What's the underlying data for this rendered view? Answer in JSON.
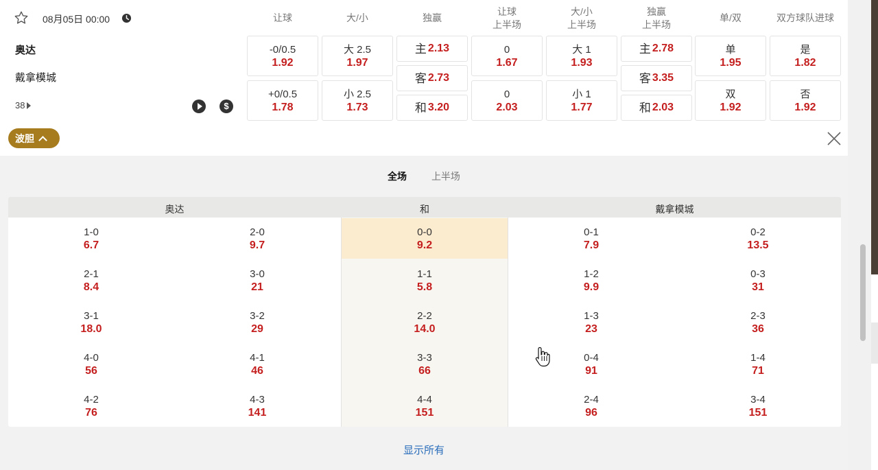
{
  "match": {
    "date_time": "08月05日 00:00",
    "home_team": "奥达",
    "away_team": "戴拿模城",
    "more_markets": "38",
    "headers": [
      {
        "line1": "让球",
        "line2": ""
      },
      {
        "line1": "大/小",
        "line2": ""
      },
      {
        "line1": "独赢",
        "line2": ""
      },
      {
        "line1": "让球",
        "line2": "上半场"
      },
      {
        "line1": "大/小",
        "line2": "上半场"
      },
      {
        "line1": "独赢",
        "line2": "上半场"
      },
      {
        "line1": "单/双",
        "line2": ""
      },
      {
        "line1": "双方球队进球",
        "line2": ""
      }
    ],
    "handicap": [
      {
        "label": "-0/0.5",
        "odd": "1.92"
      },
      {
        "label": "+0/0.5",
        "odd": "1.78"
      }
    ],
    "over_under": [
      {
        "label": "大 2.5",
        "odd": "1.97"
      },
      {
        "label": "小 2.5",
        "odd": "1.73"
      }
    ],
    "moneyline": [
      {
        "label": "主",
        "odd": "2.13"
      },
      {
        "label": "客",
        "odd": "2.73"
      },
      {
        "label": "和",
        "odd": "3.20"
      }
    ],
    "handicap_1h": [
      {
        "label": "0",
        "odd": "1.67"
      },
      {
        "label": "0",
        "odd": "2.03"
      }
    ],
    "over_under_1h": [
      {
        "label": "大 1",
        "odd": "1.93"
      },
      {
        "label": "小 1",
        "odd": "1.77"
      }
    ],
    "moneyline_1h": [
      {
        "label": "主",
        "odd": "2.78"
      },
      {
        "label": "客",
        "odd": "3.35"
      },
      {
        "label": "和",
        "odd": "2.03"
      }
    ],
    "odd_even": [
      {
        "label": "单",
        "odd": "1.95"
      },
      {
        "label": "双",
        "odd": "1.92"
      }
    ],
    "btts": [
      {
        "label": "是",
        "odd": "1.82"
      },
      {
        "label": "否",
        "odd": "1.92"
      }
    ]
  },
  "correct_score": {
    "toggle_label": "波胆",
    "tabs": [
      "全场",
      "上半场"
    ],
    "columns": {
      "home": "奥达",
      "draw": "和",
      "away": "戴拿模城"
    },
    "home_a": [
      [
        "1-0",
        "6.7"
      ],
      [
        "2-1",
        "8.4"
      ],
      [
        "3-1",
        "18.0"
      ],
      [
        "4-0",
        "56"
      ],
      [
        "4-2",
        "76"
      ]
    ],
    "home_b": [
      [
        "2-0",
        "9.7"
      ],
      [
        "3-0",
        "21"
      ],
      [
        "3-2",
        "29"
      ],
      [
        "4-1",
        "46"
      ],
      [
        "4-3",
        "141"
      ]
    ],
    "draw": [
      [
        "0-0",
        "9.2"
      ],
      [
        "1-1",
        "5.8"
      ],
      [
        "2-2",
        "14.0"
      ],
      [
        "3-3",
        "66"
      ],
      [
        "4-4",
        "151"
      ]
    ],
    "away_a": [
      [
        "0-1",
        "7.9"
      ],
      [
        "1-2",
        "9.9"
      ],
      [
        "1-3",
        "23"
      ],
      [
        "0-4",
        "91"
      ],
      [
        "2-4",
        "96"
      ]
    ],
    "away_b": [
      [
        "0-2",
        "13.5"
      ],
      [
        "0-3",
        "31"
      ],
      [
        "2-3",
        "36"
      ],
      [
        "1-4",
        "71"
      ],
      [
        "3-4",
        "151"
      ]
    ],
    "show_all": "显示所有"
  },
  "colors": {
    "odd": "#c41e1e",
    "accent": "#a67c1f",
    "link": "#2a6ebb",
    "highlight": "#fbebcf"
  }
}
